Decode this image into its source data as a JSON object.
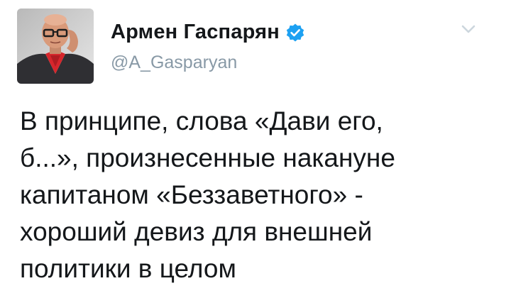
{
  "author": {
    "display_name": "Армен Гаспарян",
    "handle": "@A_Gasparyan",
    "verified": true,
    "avatar_icon": "profile-photo"
  },
  "menu": {
    "icon": "chevron-down-icon"
  },
  "tweet": {
    "lines": [
      "В принципе, слова «Дави его,",
      "б...», произнесенные накануне",
      "капитаном «Беззаветного» -",
      "хороший девиз для внешней",
      "политики в целом"
    ]
  },
  "colors": {
    "text": "#14171a",
    "secondary": "#8899a6",
    "verified_badge": "#1da1f2",
    "chevron": "#ccd6dd"
  }
}
